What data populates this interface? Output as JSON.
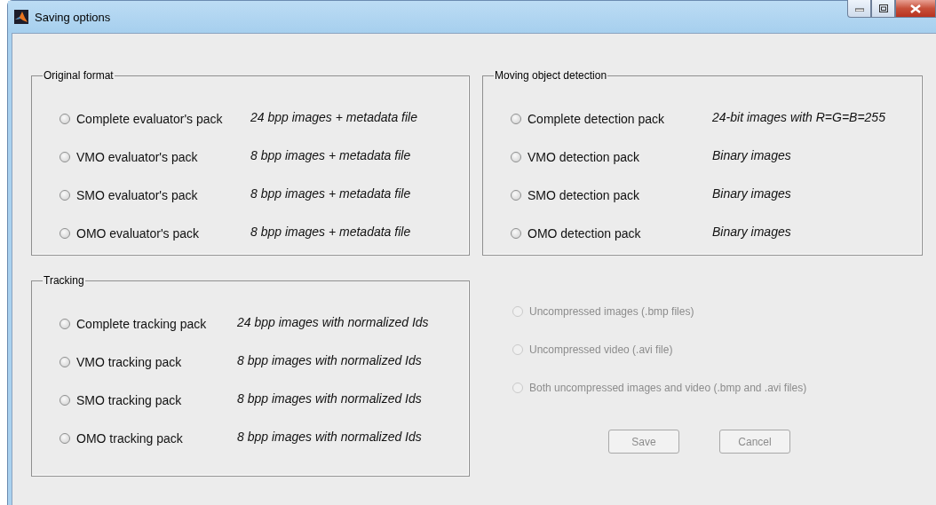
{
  "window": {
    "title": "Saving options"
  },
  "panels": [
    {
      "title": "Original format",
      "options": [
        {
          "label": "Complete evaluator's pack",
          "description": "24 bpp images + metadata file",
          "selected": false
        },
        {
          "label": "VMO evaluator's pack",
          "description": "8 bpp images + metadata file",
          "selected": false
        },
        {
          "label": "SMO evaluator's pack",
          "description": "8 bpp images + metadata file",
          "selected": false
        },
        {
          "label": "OMO evaluator's pack",
          "description": "8 bpp images + metadata file",
          "selected": false
        }
      ]
    },
    {
      "title": "Moving object detection",
      "options": [
        {
          "label": "Complete detection pack",
          "description": "24-bit images with R=G=B=255",
          "selected": false
        },
        {
          "label": "VMO detection pack",
          "description": "Binary images",
          "selected": false
        },
        {
          "label": "SMO detection pack",
          "description": "Binary images",
          "selected": false
        },
        {
          "label": "OMO detection pack",
          "description": "Binary images",
          "selected": false
        }
      ]
    },
    {
      "title": "Tracking",
      "options": [
        {
          "label": "Complete tracking pack",
          "description": "24 bpp images with normalized Ids",
          "selected": false
        },
        {
          "label": "VMO tracking pack",
          "description": "8 bpp images with normalized Ids",
          "selected": false
        },
        {
          "label": "SMO tracking pack",
          "description": "8 bpp images with normalized Ids",
          "selected": false
        },
        {
          "label": "OMO tracking pack",
          "description": "8 bpp images with normalized Ids",
          "selected": false
        }
      ]
    }
  ],
  "output_formats": [
    {
      "label": "Uncompressed images (.bmp files)",
      "selected": false,
      "disabled": true
    },
    {
      "label": "Uncompressed video (.avi file)",
      "selected": false,
      "disabled": true
    },
    {
      "label": "Both uncompressed images and video (.bmp and .avi files)",
      "selected": false,
      "disabled": true
    }
  ],
  "buttons": [
    {
      "label": "Save",
      "disabled": true
    },
    {
      "label": "Cancel",
      "disabled": true
    }
  ]
}
